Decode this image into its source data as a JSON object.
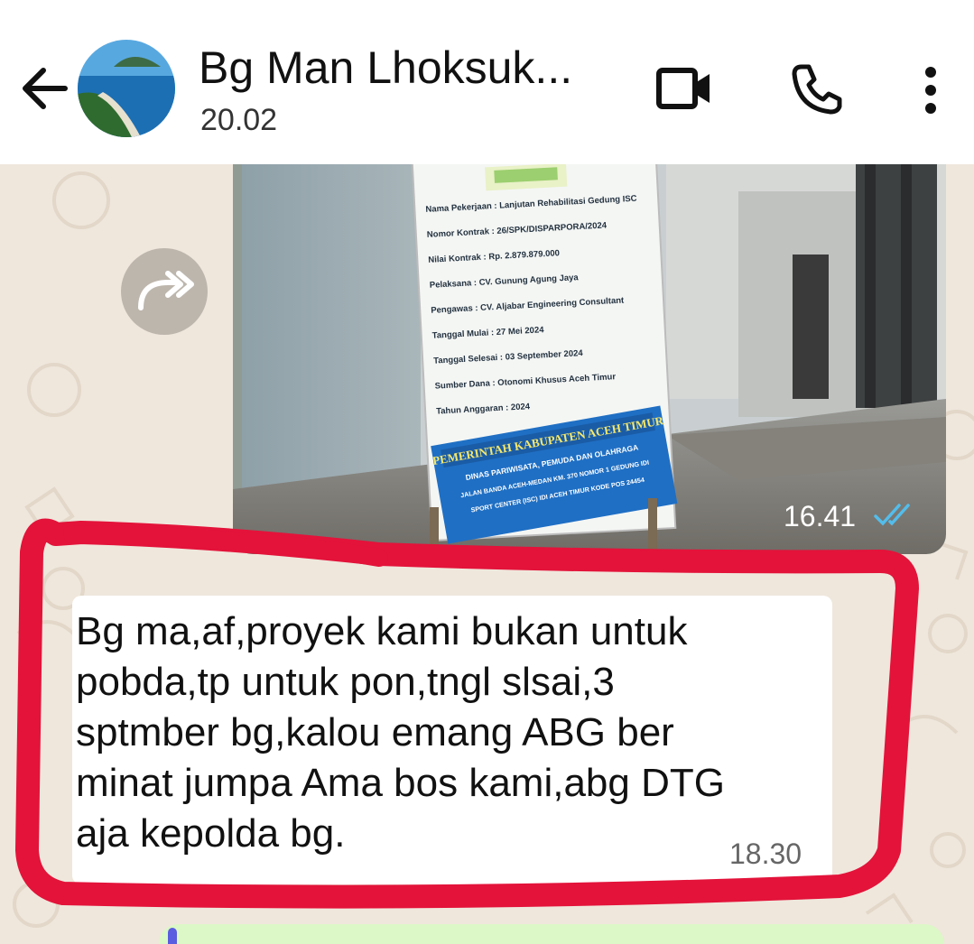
{
  "header": {
    "title": "Bg Man Lhoksuk...",
    "last_seen": "20.02",
    "icons": [
      "back-arrow-icon",
      "video-call-icon",
      "phone-call-icon",
      "more-options-icon"
    ]
  },
  "forward_icon": "forward-icon",
  "image_message": {
    "time": "16.41",
    "read_status": "double-check-icon",
    "sign": {
      "rows": [
        {
          "label": "Nama Pekerjaan",
          "value": "Lanjutan Rehabilitasi Gedung ISC"
        },
        {
          "label": "Nomor Kontrak",
          "value": "26/SPK/DISPARPORA/2024"
        },
        {
          "label": "Nilai Kontrak",
          "value": "Rp. 2.879.879.000"
        },
        {
          "label": "Pelaksana",
          "value": "CV. Gunung Agung Jaya"
        },
        {
          "label": "Pengawas",
          "value": "CV. Aljabar Engineering Consultant"
        },
        {
          "label": "Tanggal Mulai",
          "value": "27 Mei 2024"
        },
        {
          "label": "Tanggal Selesai",
          "value": "03 September 2024"
        },
        {
          "label": "Sumber Dana",
          "value": "Otonomi Khusus Aceh Timur"
        },
        {
          "label": "Tahun Anggaran",
          "value": "2024"
        }
      ],
      "banner_title": "PEMERINTAH KABUPATEN ACEH TIMUR",
      "banner_lines": [
        "DINAS PARIWISATA, PEMUDA DAN OLAHRAGA",
        "JALAN BANDA ACEH-MEDAN KM. 370 NOMOR 1 GEDUNG IDI",
        "SPORT CENTER (ISC) IDI ACEH TIMUR KODE POS 24454"
      ]
    }
  },
  "text_message": {
    "lines": [
      "Bg ma,af,proyek kami bukan untuk",
      "pobda,tp untuk pon,tngl slsai,3",
      "sptmber bg,kalou emang ABG ber",
      "minat jumpa Ama bos kami,abg DTG",
      "aja kepolda bg."
    ],
    "time": "18.30"
  },
  "colors": {
    "header_bg": "#ffffff",
    "wallpaper": "#efe7dc",
    "outgoing_bubble": "#dcf8c6",
    "incoming_bubble": "#ffffff",
    "annotation_red": "#e3133a",
    "read_tick": "#53bdeb"
  }
}
